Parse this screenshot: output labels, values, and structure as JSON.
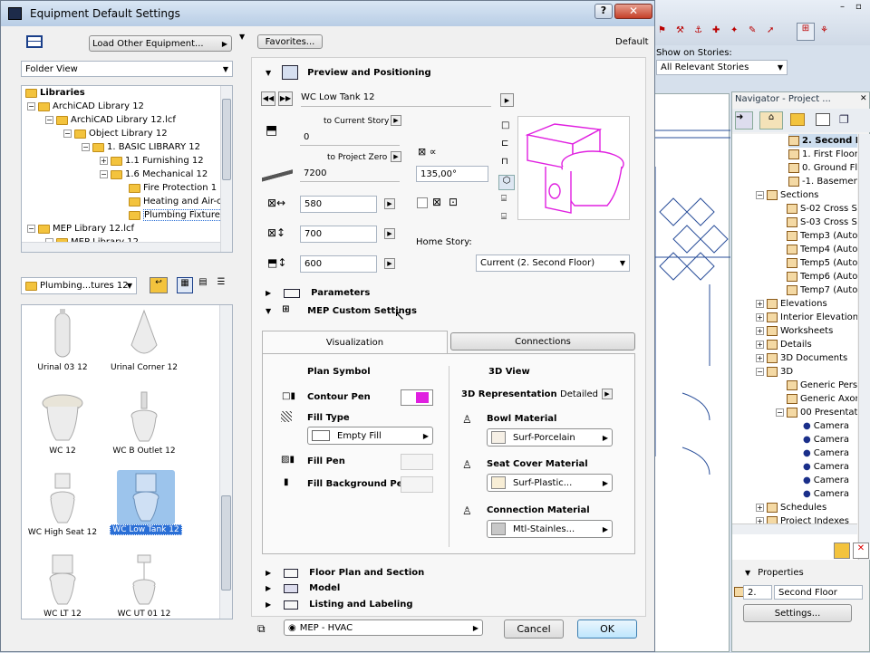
{
  "dialog": {
    "title": "Equipment Default Settings",
    "load_other": "Load Other Equipment...",
    "folder_view": "Folder View",
    "favorites": "Favorites...",
    "default_label": "Default"
  },
  "tree": {
    "items": [
      {
        "label": "Libraries"
      },
      {
        "label": "ArchiCAD Library 12"
      },
      {
        "label": "ArchiCAD Library 12.lcf"
      },
      {
        "label": "Object Library 12"
      },
      {
        "label": "1. BASIC LIBRARY 12"
      },
      {
        "label": "1.1 Furnishing 12"
      },
      {
        "label": "1.6 Mechanical 12"
      },
      {
        "label": "Fire Protection 1"
      },
      {
        "label": "Heating and Air-c"
      },
      {
        "label": "Plumbing Fixtures"
      },
      {
        "label": "MEP Library 12.lcf"
      },
      {
        "label": "MEP Library 12"
      }
    ]
  },
  "folder_select": "Plumbing...tures 12",
  "thumbnails": [
    {
      "label": "Urinal 03 12"
    },
    {
      "label": "Urinal Corner 12"
    },
    {
      "label": "WC 12"
    },
    {
      "label": "WC B Outlet 12"
    },
    {
      "label": "WC High Seat 12"
    },
    {
      "label": "WC Low Tank 12"
    },
    {
      "label": "WC LT 12"
    },
    {
      "label": "WC UT 01 12"
    }
  ],
  "preview": {
    "section_title": "Preview and Positioning",
    "object_name": "WC Low Tank 12",
    "to_current_story": "to Current Story",
    "val_0": "0",
    "to_project_zero": "to Project Zero",
    "val_7200": "7200",
    "angle": "135,00°",
    "val_580": "580",
    "val_700": "700",
    "val_600": "600",
    "home_story_label": "Home Story:",
    "home_story_value": "Current (2. Second Floor)"
  },
  "sections": {
    "parameters": "Parameters",
    "mep_custom": "MEP Custom Settings",
    "floor_plan": "Floor Plan and Section",
    "model": "Model",
    "listing": "Listing and Labeling"
  },
  "mep": {
    "tab_visualization": "Visualization",
    "tab_connections": "Connections",
    "plan_symbol": "Plan Symbol",
    "contour_pen": "Contour Pen",
    "fill_type": "Fill Type",
    "fill_type_value": "Empty Fill",
    "fill_pen": "Fill Pen",
    "fill_bg_pen": "Fill Background Pen",
    "view3d": "3D View",
    "rep3d": "3D Representation",
    "rep3d_value": "Detailed",
    "bowl_material": "Bowl Material",
    "bowl_value": "Surf-Porcelain",
    "seat_material": "Seat Cover Material",
    "seat_value": "Surf-Plastic...",
    "conn_material": "Connection Material",
    "conn_value": "Mtl-Stainles..."
  },
  "footer": {
    "layer": "MEP - HVAC",
    "cancel": "Cancel",
    "ok": "OK"
  },
  "bg": {
    "show_on_stories": "Show on Stories:",
    "stories_value": "All Relevant Stories"
  },
  "navigator": {
    "title": "Navigator - Project ...",
    "items": [
      {
        "label": "2. Second Fl"
      },
      {
        "label": "1. First Floor"
      },
      {
        "label": "0. Ground Fl"
      },
      {
        "label": "-1. Basemen"
      },
      {
        "label": "Sections"
      },
      {
        "label": "S-02 Cross S"
      },
      {
        "label": "S-03 Cross S"
      },
      {
        "label": "Temp3 (Auto"
      },
      {
        "label": "Temp4 (Auto"
      },
      {
        "label": "Temp5 (Auto"
      },
      {
        "label": "Temp6 (Auto"
      },
      {
        "label": "Temp7 (Auto"
      },
      {
        "label": "Elevations"
      },
      {
        "label": "Interior Elevation"
      },
      {
        "label": "Worksheets"
      },
      {
        "label": "Details"
      },
      {
        "label": "3D Documents"
      },
      {
        "label": "3D"
      },
      {
        "label": "Generic Pers"
      },
      {
        "label": "Generic Axon"
      },
      {
        "label": "00 Presentat"
      },
      {
        "label": "Camera"
      },
      {
        "label": "Camera"
      },
      {
        "label": "Camera"
      },
      {
        "label": "Camera"
      },
      {
        "label": "Camera"
      },
      {
        "label": "Camera"
      },
      {
        "label": "Schedules"
      },
      {
        "label": "Project Indexes"
      }
    ],
    "properties": "Properties",
    "prop_num": "2.",
    "prop_value": "Second Floor",
    "settings": "Settings..."
  },
  "colors": {
    "accent": "#2a6fd6",
    "magenta": "#e020e0",
    "titlebar": "#bfd3ea"
  }
}
